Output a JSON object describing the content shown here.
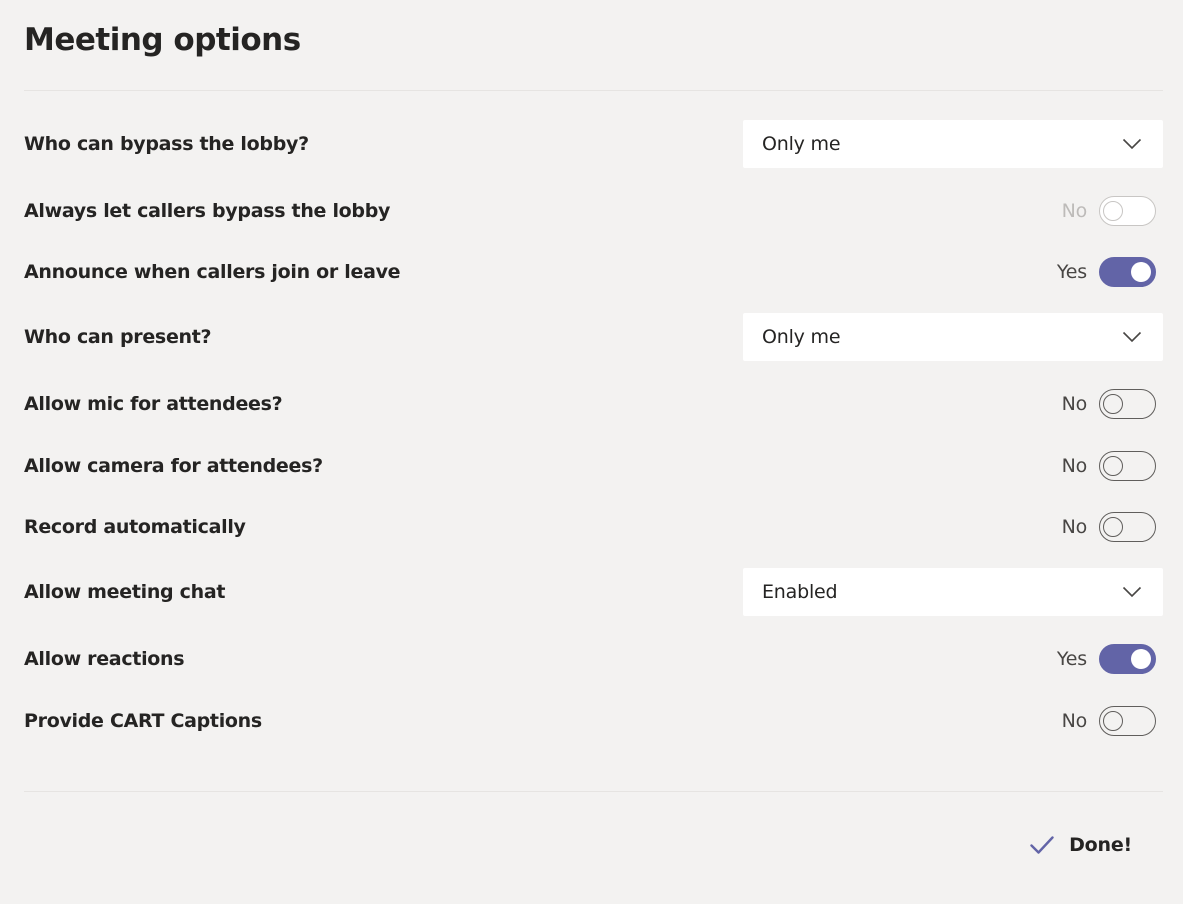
{
  "page": {
    "title": "Meeting options",
    "done_label": "Done!",
    "accent_color": "#6264a7"
  },
  "options": {
    "bypass_lobby": {
      "label": "Who can bypass the lobby?",
      "value": "Only me",
      "icon": "chevron-down-icon"
    },
    "callers_bypass": {
      "label": "Always let callers bypass the lobby",
      "state_label": "No",
      "on": false,
      "disabled": true
    },
    "announce_callers": {
      "label": "Announce when callers join or leave",
      "state_label": "Yes",
      "on": true,
      "disabled": false
    },
    "who_can_present": {
      "label": "Who can present?",
      "value": "Only me",
      "icon": "chevron-down-icon"
    },
    "allow_mic": {
      "label": "Allow mic for attendees?",
      "state_label": "No",
      "on": false,
      "disabled": false
    },
    "allow_camera": {
      "label": "Allow camera for attendees?",
      "state_label": "No",
      "on": false,
      "disabled": false
    },
    "record_automatically": {
      "label": "Record automatically",
      "state_label": "No",
      "on": false,
      "disabled": false
    },
    "meeting_chat": {
      "label": "Allow meeting chat",
      "value": "Enabled",
      "icon": "chevron-down-icon"
    },
    "allow_reactions": {
      "label": "Allow reactions",
      "state_label": "Yes",
      "on": true,
      "disabled": false
    },
    "cart_captions": {
      "label": "Provide CART Captions",
      "state_label": "No",
      "on": false,
      "disabled": false
    }
  }
}
